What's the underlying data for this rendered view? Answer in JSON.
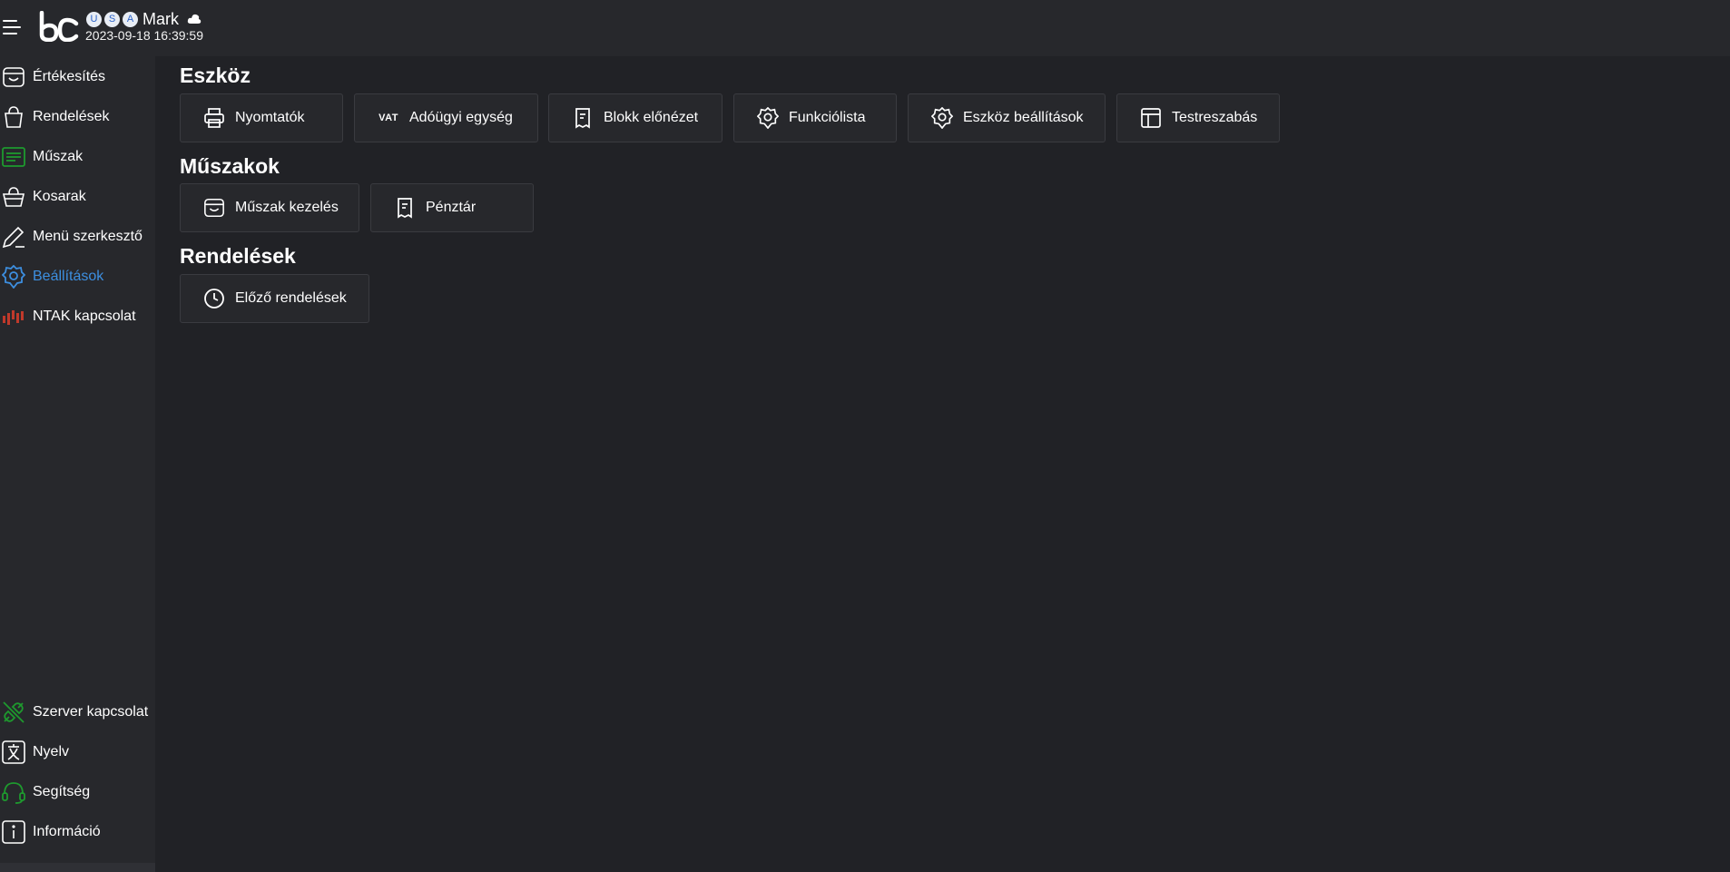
{
  "header": {
    "badges": [
      "U",
      "S",
      "A"
    ],
    "user_name": "Mark",
    "timestamp": "2023-09-18 16:39:59"
  },
  "sidebar": {
    "items": [
      {
        "label": "Értékesítés",
        "icon": "shop-icon",
        "active": false
      },
      {
        "label": "Rendelések",
        "icon": "shopping-bag-icon",
        "active": false
      },
      {
        "label": "Műszak",
        "icon": "shift-list-icon",
        "active": false
      },
      {
        "label": "Kosarak",
        "icon": "basket-icon",
        "active": false
      },
      {
        "label": "Menü szerkesztő",
        "icon": "pencil-icon",
        "active": false
      },
      {
        "label": "Beállítások",
        "icon": "gear-icon",
        "active": true
      },
      {
        "label": "NTAK kapcsolat",
        "icon": "ntak-signal-icon",
        "active": false
      }
    ],
    "bottom_items": [
      {
        "label": "Szerver kapcsolat",
        "icon": "server-connection-icon"
      },
      {
        "label": "Nyelv",
        "icon": "language-icon"
      },
      {
        "label": "Segítség",
        "icon": "headset-icon"
      },
      {
        "label": "Információ",
        "icon": "info-icon"
      }
    ]
  },
  "sections": {
    "device": {
      "title": "Eszköz",
      "buttons": [
        {
          "label": "Nyomtatók",
          "icon": "printer-icon"
        },
        {
          "label": "Adóügyi egység",
          "icon": "vat-icon",
          "icon_text": "VAT"
        },
        {
          "label": "Blokk előnézet",
          "icon": "receipt-icon"
        },
        {
          "label": "Funkciólista",
          "icon": "gear-icon"
        },
        {
          "label": "Eszköz beállítások",
          "icon": "gear-icon"
        },
        {
          "label": "Testreszabás",
          "icon": "layout-icon"
        }
      ]
    },
    "shifts": {
      "title": "Műszakok",
      "buttons": [
        {
          "label": "Műszak kezelés",
          "icon": "shop-icon"
        },
        {
          "label": "Pénztár",
          "icon": "receipt-icon"
        }
      ]
    },
    "orders": {
      "title": "Rendelések",
      "buttons": [
        {
          "label": "Előző rendelések",
          "icon": "clock-icon"
        }
      ]
    }
  },
  "colors": {
    "background": "#212226",
    "panel": "#27282c",
    "accent_blue": "#3d8fe0",
    "status_green": "#1e9a2e",
    "ntak_red": "#c0392b"
  }
}
